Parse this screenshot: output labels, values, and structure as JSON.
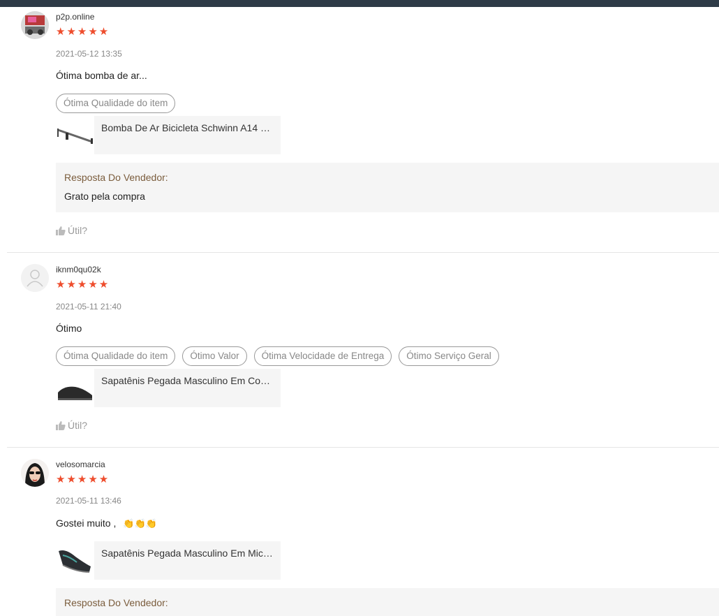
{
  "reviews": [
    {
      "username": "p2p.online",
      "stars": "★★★★★",
      "rating": 5,
      "time": "2021-05-12 13:35",
      "comment": "Ótima bomba de ar...",
      "tags": [
        "Ótima Qualidade do item"
      ],
      "product": "Bomba De Ar Bicicleta Schwinn A14 1...",
      "seller_reply_title": "Resposta Do Vendedor:",
      "seller_reply": "Grato pela compra",
      "helpful": "Útil?"
    },
    {
      "username": "iknm0qu02k",
      "stars": "★★★★★",
      "rating": 5,
      "time": "2021-05-11 21:40",
      "comment": "Ótimo",
      "tags": [
        "Ótima Qualidade do item",
        "Ótimo Valor",
        "Ótima Velocidade de Entrega",
        "Ótimo Serviço Geral"
      ],
      "product": "Sapatênis Pegada Masculino Em Cour...",
      "helpful": "Útil?"
    },
    {
      "username": "velosomarcia",
      "stars": "★★★★★",
      "rating": 5,
      "time": "2021-05-11 13:46",
      "comment": "Gostei muito ,",
      "emoji": "👏👏👏",
      "product": "Sapatênis Pegada Masculino Em Micr...",
      "seller_reply_title": "Resposta Do Vendedor:"
    }
  ],
  "colors": {
    "star": "#ee4d2d",
    "seller_title": "#7a5c3c",
    "topbar": "#2e3b47"
  }
}
